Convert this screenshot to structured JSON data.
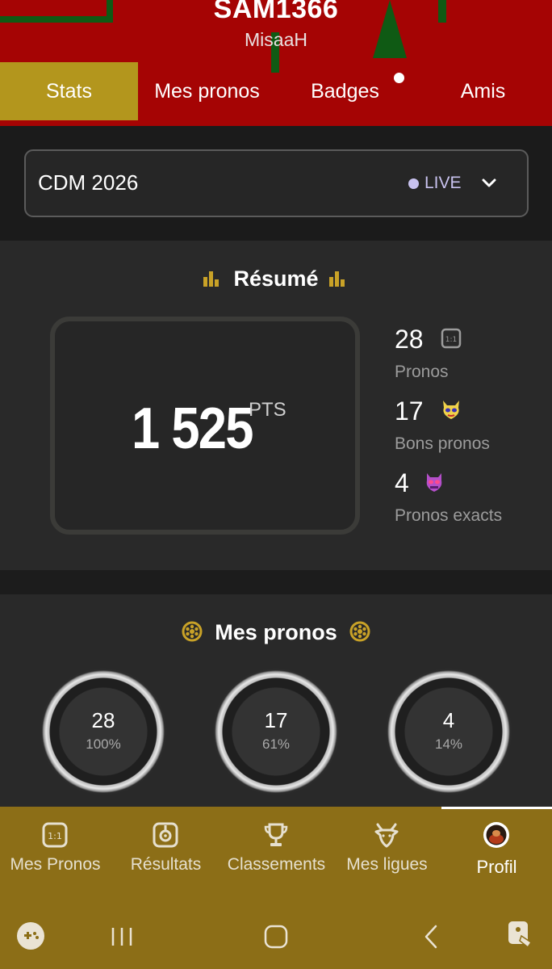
{
  "profile": {
    "username": "SAM1366",
    "subtitle": "MisaaH"
  },
  "tabs": [
    {
      "label": "Stats",
      "active": true
    },
    {
      "label": "Mes pronos",
      "active": false
    },
    {
      "label": "Badges",
      "active": false
    },
    {
      "label": "Amis",
      "active": false
    }
  ],
  "competition": {
    "name": "CDM 2026",
    "status": "LIVE"
  },
  "resume": {
    "title": "Résumé",
    "points": "1 525",
    "points_unit": "PTS",
    "stats": [
      {
        "value": "28",
        "label": "Pronos",
        "icon": "score-box-icon"
      },
      {
        "value": "17",
        "label": "Bons pronos",
        "icon": "yellow-mask-icon"
      },
      {
        "value": "4",
        "label": "Pronos exacts",
        "icon": "purple-mask-icon"
      }
    ]
  },
  "mes_pronos": {
    "title": "Mes pronos",
    "rings": [
      {
        "value": "28",
        "percent": "100%"
      },
      {
        "value": "17",
        "percent": "61%"
      },
      {
        "value": "4",
        "percent": "14%"
      }
    ]
  },
  "bottom_nav": [
    {
      "label": "Mes Pronos",
      "icon": "score-box-icon",
      "active": false
    },
    {
      "label": "Résultats",
      "icon": "whistle-icon",
      "active": false
    },
    {
      "label": "Classements",
      "icon": "trophy-icon",
      "active": false
    },
    {
      "label": "Mes ligues",
      "icon": "goat-icon",
      "active": false
    },
    {
      "label": "Profil",
      "icon": "avatar-icon",
      "active": true
    }
  ],
  "colors": {
    "header_red": "#a50404",
    "accent_gold": "#b3961d",
    "nav_gold": "#8c6e17",
    "live_lavender": "#c8c2ef"
  }
}
